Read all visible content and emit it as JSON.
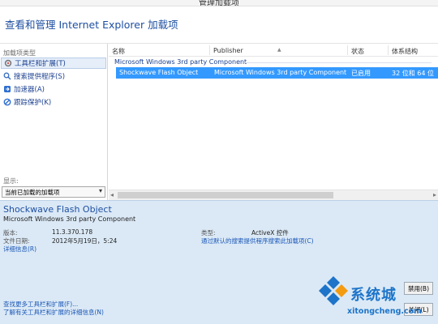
{
  "window": {
    "title": "管理加载项"
  },
  "header": {
    "title": "查看和管理 Internet Explorer 加载项"
  },
  "left_pane": {
    "section_label": "加载项类型",
    "types": [
      {
        "label": "工具栏和扩展(T)",
        "icon": "gear-icon"
      },
      {
        "label": "搜索提供程序(S)",
        "icon": "search-icon"
      },
      {
        "label": "加速器(A)",
        "icon": "accelerator-icon"
      },
      {
        "label": "跟踪保护(K)",
        "icon": "block-icon"
      }
    ],
    "show_label": "显示:",
    "show_value": "当前已加载的加载项"
  },
  "list": {
    "columns": [
      "名称",
      "Publisher",
      "状态",
      "体系结构"
    ],
    "group": "Microsoft Windows 3rd party Component",
    "rows": [
      {
        "name": "Shockwave Flash Object",
        "publisher": "Microsoft Windows 3rd party Component",
        "status": "已启用",
        "arch": "32 位和 64 位"
      }
    ]
  },
  "details": {
    "name": "Shockwave Flash Object",
    "publisher": "Microsoft Windows 3rd party Component",
    "version_label": "版本:",
    "version": "11.3.370.178",
    "date_label": "文件日期:",
    "date": "2012年5月19日，5:24",
    "more_info": "详细信息(R)",
    "type_label": "类型:",
    "type": "ActiveX 控件",
    "search_link": "通过默认的搜索提供程序搜索此加载项(C)",
    "find_more": "查找更多工具栏和扩展(F)...",
    "learn_more": "了解有关工具栏和扩展的详细信息(N)"
  },
  "buttons": {
    "disable": "禁用(B)",
    "close": "关闭(L)"
  },
  "watermark": {
    "text": "系统城",
    "url": "xitongcheng.com"
  }
}
